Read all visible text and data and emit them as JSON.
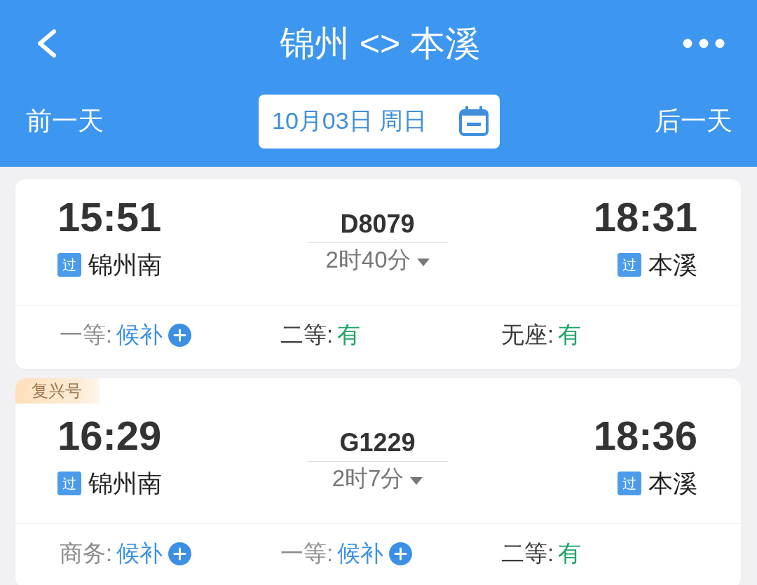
{
  "header": {
    "title": "锦州 <> 本溪",
    "prev_day": "前一天",
    "date": "10月03日 周日",
    "next_day": "后一天"
  },
  "trains": [
    {
      "depart_time": "15:51",
      "depart_tag": "过",
      "depart_station": "锦州南",
      "train_no": "D8079",
      "duration": "2时40分",
      "arrive_time": "18:31",
      "arrive_tag": "过",
      "arrive_station": "本溪",
      "seats": [
        {
          "kind": "waitlist",
          "label": "一等:",
          "status": "候补"
        },
        {
          "kind": "available",
          "label": "二等:",
          "status": "有"
        },
        {
          "kind": "available",
          "label": "无座:",
          "status": "有"
        }
      ]
    },
    {
      "badge": "复兴号",
      "depart_time": "16:29",
      "depart_tag": "过",
      "depart_station": "锦州南",
      "train_no": "G1229",
      "duration": "2时7分",
      "arrive_time": "18:36",
      "arrive_tag": "过",
      "arrive_station": "本溪",
      "seats": [
        {
          "kind": "waitlist",
          "label": "商务:",
          "status": "候补"
        },
        {
          "kind": "waitlist",
          "label": "一等:",
          "status": "候补"
        },
        {
          "kind": "available",
          "label": "二等:",
          "status": "有"
        }
      ]
    }
  ]
}
